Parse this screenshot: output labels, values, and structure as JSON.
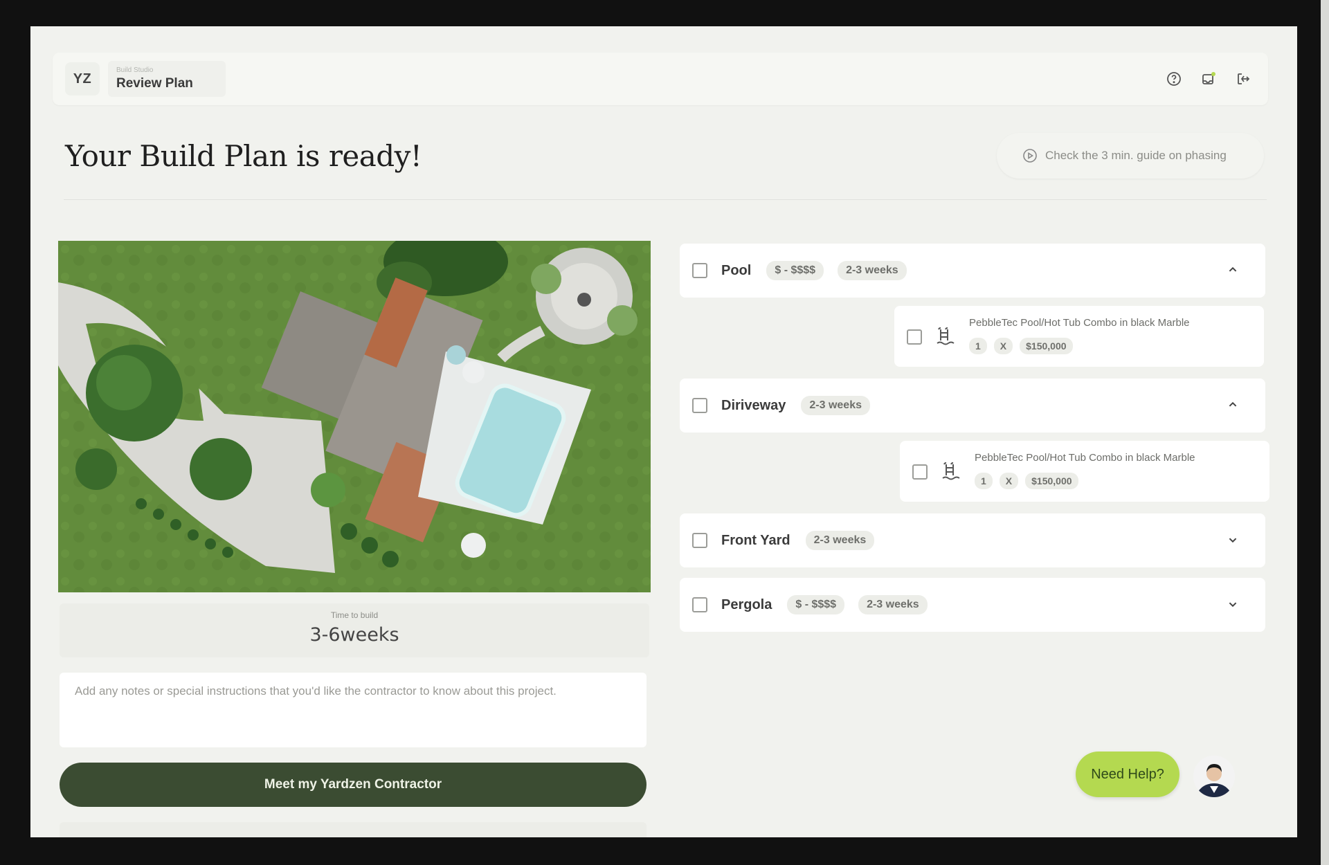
{
  "header": {
    "logo_text": "YZ",
    "crumb_small": "Build Studio",
    "crumb_title": "Review Plan",
    "icons": [
      "help-circle-icon",
      "notification-icon",
      "logout-icon"
    ]
  },
  "page": {
    "title": "Your Build Plan is ready!",
    "guide_link": "Check the 3 min. guide on phasing"
  },
  "left": {
    "time_label": "Time to build",
    "time_value": "3-6weeks",
    "notes_placeholder": "Add any notes or special instructions that you'd like the contractor to know about this project.",
    "cta_label": "Meet my Yardzen Contractor"
  },
  "plan_items": [
    {
      "title": "Pool",
      "price": "$ - $$$$",
      "duration": "2-3 weeks",
      "expanded": true,
      "sub": {
        "title": "PebbleTec Pool/Hot Tub Combo in black Marble",
        "qty": "1",
        "x": "X",
        "price": "$150,000"
      }
    },
    {
      "title": "Diriveway",
      "duration": "2-3 weeks",
      "expanded": true,
      "sub": {
        "title": "PebbleTec Pool/Hot Tub Combo in black Marble",
        "qty": "1",
        "x": "X",
        "price": "$150,000"
      }
    },
    {
      "title": "Front Yard",
      "duration": "2-3 weeks",
      "expanded": false
    },
    {
      "title": "Pergola",
      "price": "$ - $$$$",
      "duration": "2-3 weeks",
      "expanded": false
    }
  ],
  "help": {
    "label": "Need Help?"
  },
  "colors": {
    "accent_green": "#b4d950",
    "cta_dark_green": "#3b4c32",
    "page_bg": "#f1f2ee"
  }
}
